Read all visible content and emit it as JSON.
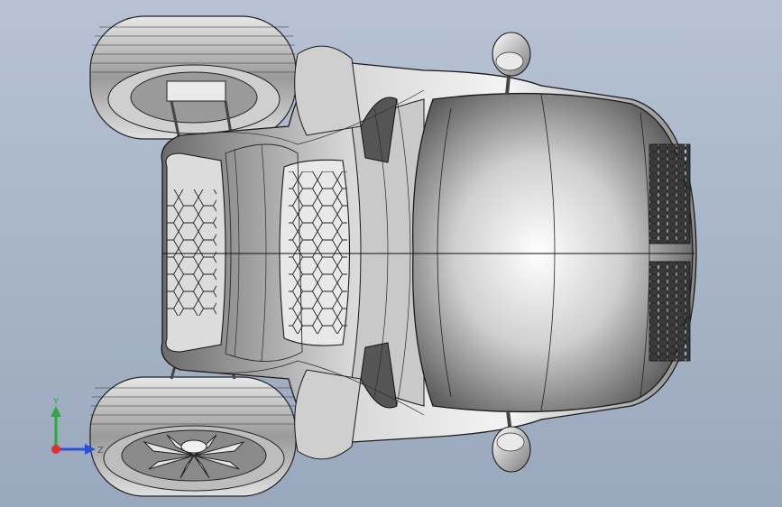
{
  "viewport": {
    "background_top": "#b7c3d4",
    "background_bottom": "#9aa8bd",
    "model": "vehicle-body-top-view"
  },
  "triad": {
    "y_label": "Y",
    "z_label": "Z",
    "x_color": "#e03030",
    "y_color": "#2eaa3a",
    "z_color": "#2a4fd8"
  }
}
